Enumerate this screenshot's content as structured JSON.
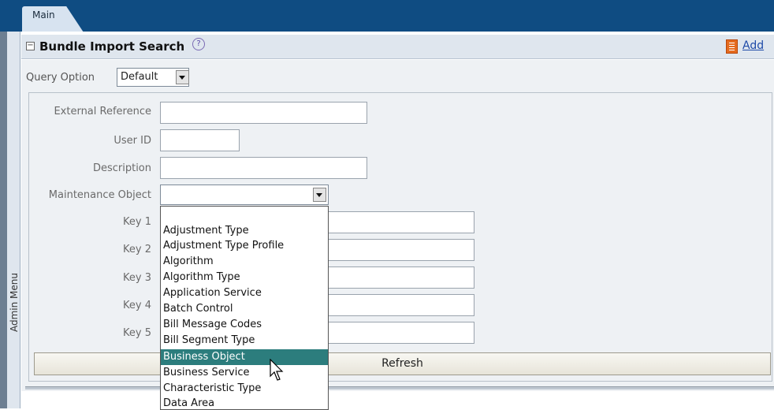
{
  "tabs": {
    "main": "Main"
  },
  "sidebar": {
    "label": "Admin Menu"
  },
  "header": {
    "title": "Bundle Import Search",
    "help_glyph": "?",
    "add_label": "Add"
  },
  "query": {
    "label": "Query Option",
    "value": "Default"
  },
  "fields": [
    {
      "label": "External Reference",
      "value": ""
    },
    {
      "label": "User ID",
      "value": ""
    },
    {
      "label": "Description",
      "value": ""
    },
    {
      "label": "Maintenance Object",
      "value": ""
    },
    {
      "label": "Key 1",
      "value": ""
    },
    {
      "label": "Key 2",
      "value": ""
    },
    {
      "label": "Key 3",
      "value": ""
    },
    {
      "label": "Key 4",
      "value": ""
    },
    {
      "label": "Key 5",
      "value": ""
    }
  ],
  "refresh_label": "Refresh",
  "dropdown": {
    "options": [
      "",
      "Adjustment Type",
      "Adjustment Type Profile",
      "Algorithm",
      "Algorithm Type",
      "Application Service",
      "Batch Control",
      "Bill Message Codes",
      "Bill Segment Type",
      "Business Object",
      "Business Service",
      "Characteristic Type",
      "Data Area"
    ],
    "highlighted": "Business Object"
  },
  "colors": {
    "top_bar": "#0f4c82",
    "selection": "#2c7d7d",
    "link": "#1e4aa8"
  }
}
